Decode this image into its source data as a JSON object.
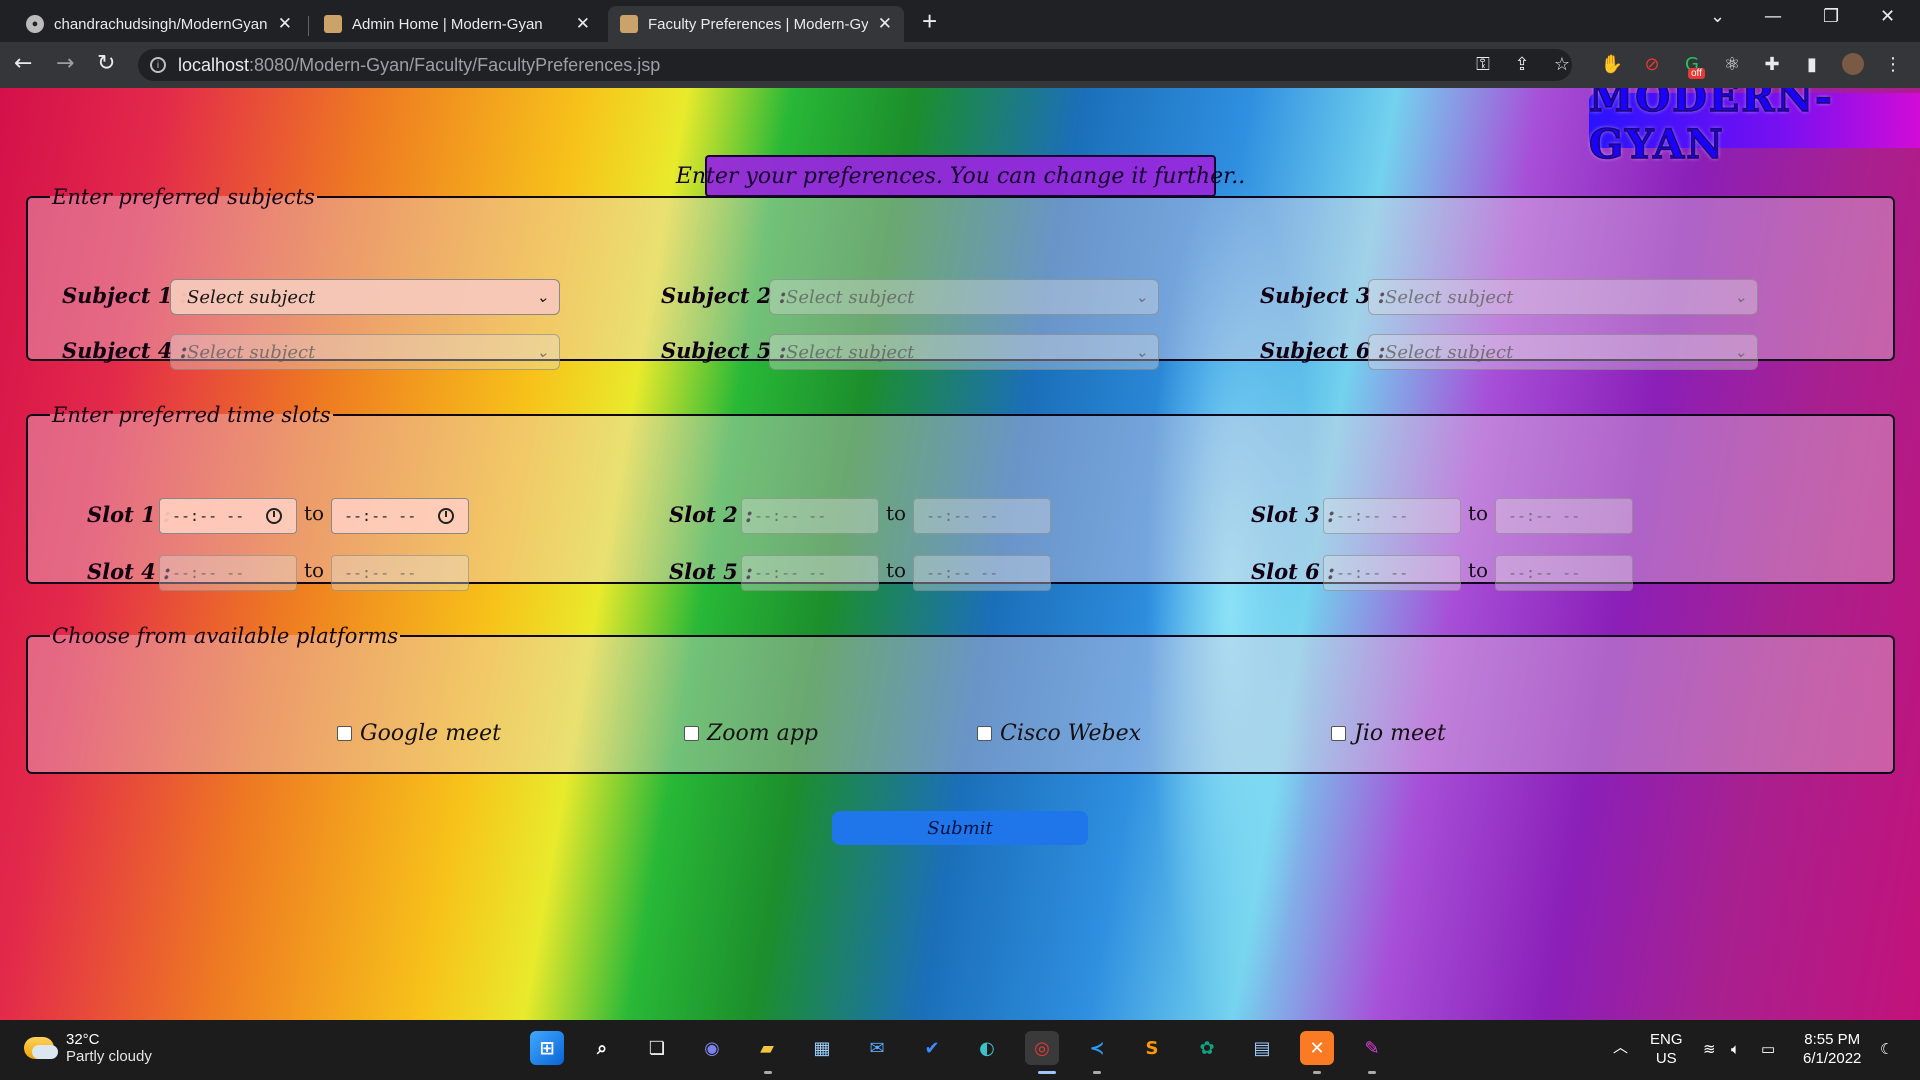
{
  "browser": {
    "tabs": [
      {
        "title": "chandrachudsingh/ModernGyan",
        "active": false
      },
      {
        "title": "Admin Home | Modern-Gyan",
        "active": false
      },
      {
        "title": "Faculty Preferences | Modern-Gy",
        "active": true
      }
    ],
    "new_tab": "+",
    "url_host": "localhost",
    "url_path": ":8080/Modern-Gyan/Faculty/FacultyPreferences.jsp",
    "extension_badge": "off"
  },
  "page": {
    "brand": "MODERN-GYAN",
    "headline": "Enter your preferences. You can change it further..",
    "subjects_legend": "Enter preferred subjects",
    "subjects": [
      {
        "label": "Subject 1 :",
        "placeholder": "Select subject",
        "enabled": true
      },
      {
        "label": "Subject 2 :",
        "placeholder": "Select subject",
        "enabled": false
      },
      {
        "label": "Subject 3 :",
        "placeholder": "Select subject",
        "enabled": false
      },
      {
        "label": "Subject 4 :",
        "placeholder": "Select subject",
        "enabled": false
      },
      {
        "label": "Subject 5 :",
        "placeholder": "Select subject",
        "enabled": false
      },
      {
        "label": "Subject 6 :",
        "placeholder": "Select subject",
        "enabled": false
      }
    ],
    "slots_legend": "Enter preferred time slots",
    "slots": [
      {
        "label": "Slot 1 :",
        "from": "--:-- --",
        "to_word": "to",
        "to": "--:-- --",
        "enabled": true
      },
      {
        "label": "Slot 2 :",
        "from": "--:-- --",
        "to_word": "to",
        "to": "--:-- --",
        "enabled": false
      },
      {
        "label": "Slot 3 :",
        "from": "--:-- --",
        "to_word": "to",
        "to": "--:-- --",
        "enabled": false
      },
      {
        "label": "Slot 4 :",
        "from": "--:-- --",
        "to_word": "to",
        "to": "--:-- --",
        "enabled": false
      },
      {
        "label": "Slot 5 :",
        "from": "--:-- --",
        "to_word": "to",
        "to": "--:-- --",
        "enabled": false
      },
      {
        "label": "Slot 6 :",
        "from": "--:-- --",
        "to_word": "to",
        "to": "--:-- --",
        "enabled": false
      }
    ],
    "platforms_legend": "Choose from available platforms",
    "platforms": [
      "Google meet",
      "Zoom app",
      "Cisco Webex",
      "Jio meet"
    ],
    "submit_label": "Submit"
  },
  "taskbar": {
    "temperature": "32°C",
    "weather": "Partly cloudy",
    "language": "ENG",
    "region": "US",
    "time": "8:55 PM",
    "date": "6/1/2022"
  },
  "colors": {
    "submit": "#1f75ea",
    "headline_bg": "#9628dc",
    "brand_gradient_start": "#2a12ff",
    "brand_gradient_end": "#d20cd6"
  }
}
